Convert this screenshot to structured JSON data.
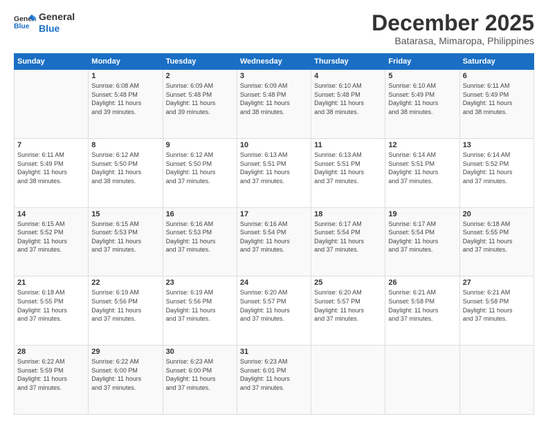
{
  "logo": {
    "line1": "General",
    "line2": "Blue"
  },
  "header": {
    "month": "December 2025",
    "location": "Batarasa, Mimaropa, Philippines"
  },
  "days_of_week": [
    "Sunday",
    "Monday",
    "Tuesday",
    "Wednesday",
    "Thursday",
    "Friday",
    "Saturday"
  ],
  "weeks": [
    [
      {
        "day": "",
        "info": ""
      },
      {
        "day": "1",
        "info": "Sunrise: 6:08 AM\nSunset: 5:48 PM\nDaylight: 11 hours\nand 39 minutes."
      },
      {
        "day": "2",
        "info": "Sunrise: 6:09 AM\nSunset: 5:48 PM\nDaylight: 11 hours\nand 39 minutes."
      },
      {
        "day": "3",
        "info": "Sunrise: 6:09 AM\nSunset: 5:48 PM\nDaylight: 11 hours\nand 38 minutes."
      },
      {
        "day": "4",
        "info": "Sunrise: 6:10 AM\nSunset: 5:48 PM\nDaylight: 11 hours\nand 38 minutes."
      },
      {
        "day": "5",
        "info": "Sunrise: 6:10 AM\nSunset: 5:49 PM\nDaylight: 11 hours\nand 38 minutes."
      },
      {
        "day": "6",
        "info": "Sunrise: 6:11 AM\nSunset: 5:49 PM\nDaylight: 11 hours\nand 38 minutes."
      }
    ],
    [
      {
        "day": "7",
        "info": "Sunrise: 6:11 AM\nSunset: 5:49 PM\nDaylight: 11 hours\nand 38 minutes."
      },
      {
        "day": "8",
        "info": "Sunrise: 6:12 AM\nSunset: 5:50 PM\nDaylight: 11 hours\nand 38 minutes."
      },
      {
        "day": "9",
        "info": "Sunrise: 6:12 AM\nSunset: 5:50 PM\nDaylight: 11 hours\nand 37 minutes."
      },
      {
        "day": "10",
        "info": "Sunrise: 6:13 AM\nSunset: 5:51 PM\nDaylight: 11 hours\nand 37 minutes."
      },
      {
        "day": "11",
        "info": "Sunrise: 6:13 AM\nSunset: 5:51 PM\nDaylight: 11 hours\nand 37 minutes."
      },
      {
        "day": "12",
        "info": "Sunrise: 6:14 AM\nSunset: 5:51 PM\nDaylight: 11 hours\nand 37 minutes."
      },
      {
        "day": "13",
        "info": "Sunrise: 6:14 AM\nSunset: 5:52 PM\nDaylight: 11 hours\nand 37 minutes."
      }
    ],
    [
      {
        "day": "14",
        "info": "Sunrise: 6:15 AM\nSunset: 5:52 PM\nDaylight: 11 hours\nand 37 minutes."
      },
      {
        "day": "15",
        "info": "Sunrise: 6:15 AM\nSunset: 5:53 PM\nDaylight: 11 hours\nand 37 minutes."
      },
      {
        "day": "16",
        "info": "Sunrise: 6:16 AM\nSunset: 5:53 PM\nDaylight: 11 hours\nand 37 minutes."
      },
      {
        "day": "17",
        "info": "Sunrise: 6:16 AM\nSunset: 5:54 PM\nDaylight: 11 hours\nand 37 minutes."
      },
      {
        "day": "18",
        "info": "Sunrise: 6:17 AM\nSunset: 5:54 PM\nDaylight: 11 hours\nand 37 minutes."
      },
      {
        "day": "19",
        "info": "Sunrise: 6:17 AM\nSunset: 5:54 PM\nDaylight: 11 hours\nand 37 minutes."
      },
      {
        "day": "20",
        "info": "Sunrise: 6:18 AM\nSunset: 5:55 PM\nDaylight: 11 hours\nand 37 minutes."
      }
    ],
    [
      {
        "day": "21",
        "info": "Sunrise: 6:18 AM\nSunset: 5:55 PM\nDaylight: 11 hours\nand 37 minutes."
      },
      {
        "day": "22",
        "info": "Sunrise: 6:19 AM\nSunset: 5:56 PM\nDaylight: 11 hours\nand 37 minutes."
      },
      {
        "day": "23",
        "info": "Sunrise: 6:19 AM\nSunset: 5:56 PM\nDaylight: 11 hours\nand 37 minutes."
      },
      {
        "day": "24",
        "info": "Sunrise: 6:20 AM\nSunset: 5:57 PM\nDaylight: 11 hours\nand 37 minutes."
      },
      {
        "day": "25",
        "info": "Sunrise: 6:20 AM\nSunset: 5:57 PM\nDaylight: 11 hours\nand 37 minutes."
      },
      {
        "day": "26",
        "info": "Sunrise: 6:21 AM\nSunset: 5:58 PM\nDaylight: 11 hours\nand 37 minutes."
      },
      {
        "day": "27",
        "info": "Sunrise: 6:21 AM\nSunset: 5:58 PM\nDaylight: 11 hours\nand 37 minutes."
      }
    ],
    [
      {
        "day": "28",
        "info": "Sunrise: 6:22 AM\nSunset: 5:59 PM\nDaylight: 11 hours\nand 37 minutes."
      },
      {
        "day": "29",
        "info": "Sunrise: 6:22 AM\nSunset: 6:00 PM\nDaylight: 11 hours\nand 37 minutes."
      },
      {
        "day": "30",
        "info": "Sunrise: 6:23 AM\nSunset: 6:00 PM\nDaylight: 11 hours\nand 37 minutes."
      },
      {
        "day": "31",
        "info": "Sunrise: 6:23 AM\nSunset: 6:01 PM\nDaylight: 11 hours\nand 37 minutes."
      },
      {
        "day": "",
        "info": ""
      },
      {
        "day": "",
        "info": ""
      },
      {
        "day": "",
        "info": ""
      }
    ]
  ]
}
